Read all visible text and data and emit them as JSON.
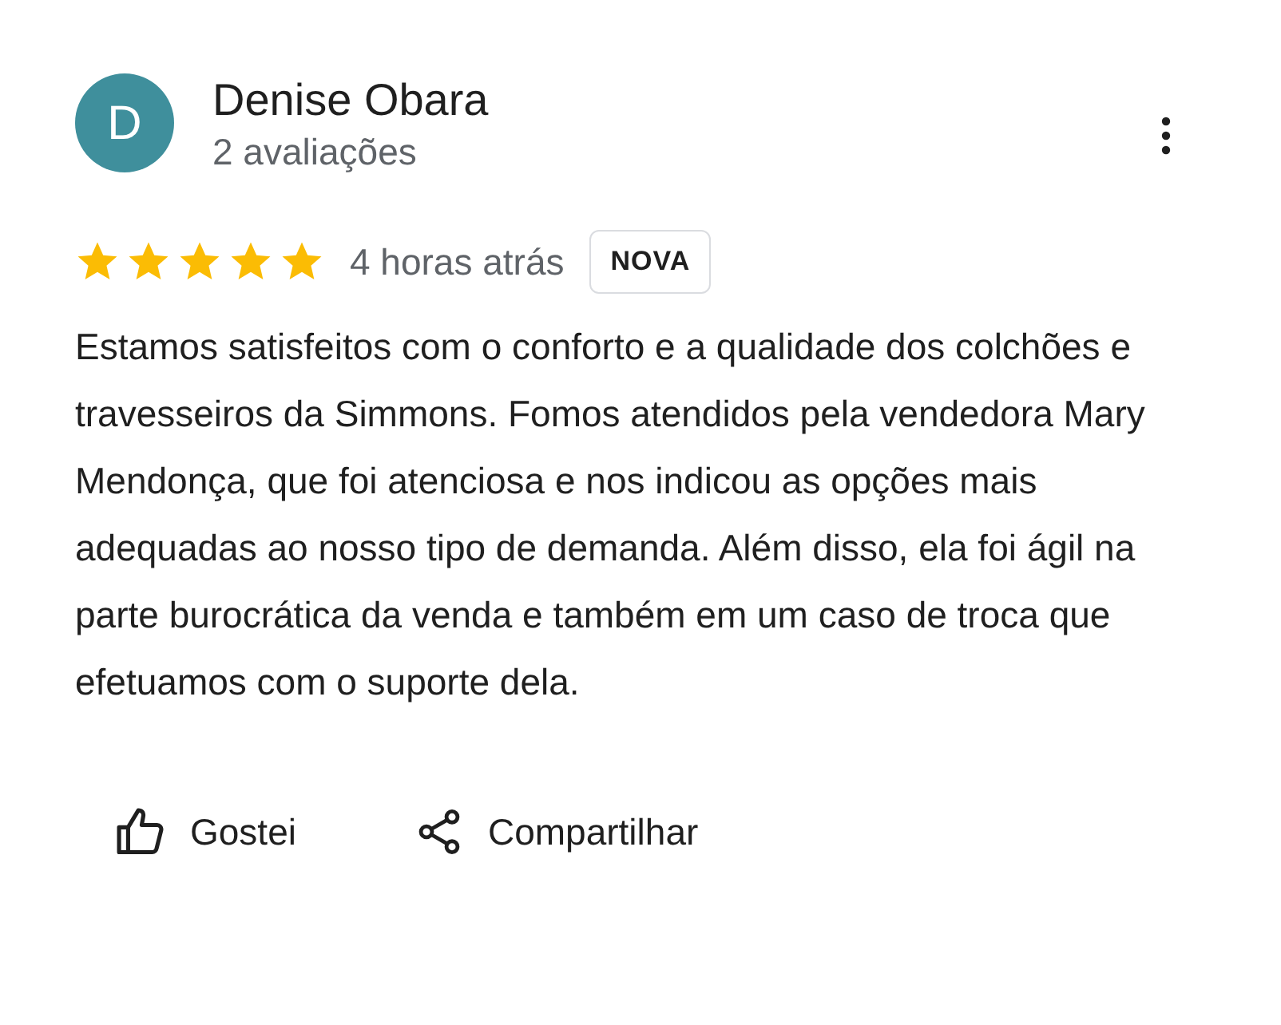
{
  "reviewer": {
    "initial": "D",
    "name": "Denise Obara",
    "review_count": "2 avaliações"
  },
  "review": {
    "stars": 5,
    "time": "4 horas atrás",
    "badge": "NOVA",
    "text": "Estamos satisfeitos com o conforto e a qualidade dos colchões e travesseiros da Simmons. Fomos atendidos pela vendedora Mary Mendonça, que foi atenciosa e nos indicou as opções mais adequadas ao nosso tipo de demanda. Além disso, ela foi ágil na parte burocrática da venda e também em um caso de troca que efetuamos com o suporte dela."
  },
  "actions": [
    {
      "kind": "like",
      "label": "Gostei"
    },
    {
      "kind": "share",
      "label": "Compartilhar"
    }
  ]
}
